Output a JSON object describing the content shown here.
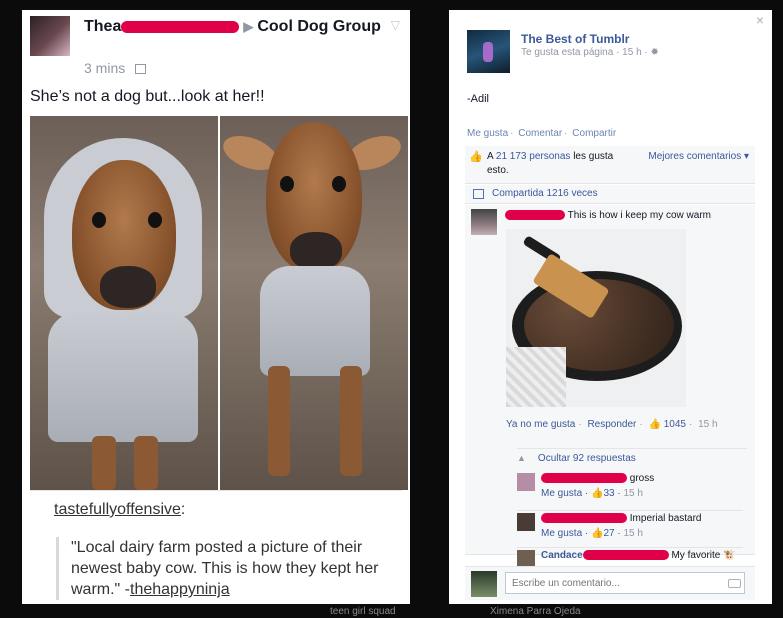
{
  "post": {
    "author_first": "Thea",
    "target_group": "Cool Dog Group",
    "time": "3 mins",
    "text": "She’s not a dog but...look at her!!",
    "source_user": "tastefullyoffensive",
    "source_colon": ":",
    "quote": "\"Local dairy farm posted a picture of their newest baby cow. This is how they kept her warm.\" -",
    "quote_author": "thehappyninja"
  },
  "panel": {
    "page_name": "The Best of Tumblr",
    "page_meta": "Te gusta esta página · 15 h ·",
    "caption": "-Adil",
    "actions": [
      "Me gusta",
      "Comentar",
      "Compartir"
    ],
    "likes_prefix": "A",
    "likes_count": "21 173 personas",
    "likes_suffix": "les gusta esto.",
    "sort_label": "Mejores comentarios ▾",
    "shares": "Compartida 1216 veces",
    "comment": {
      "text": "This is how i keep my cow warm",
      "unlike": "Ya no me gusta",
      "reply": "Responder",
      "likes": "1045",
      "time": "15 h"
    },
    "hide_replies": "Ocultar 92 respuestas",
    "replies": [
      {
        "text": "gross",
        "action": "Me gusta",
        "likes": "33",
        "time": "15 h"
      },
      {
        "text": "Imperial bastard",
        "action": "Me gusta",
        "likes": "27",
        "time": "15 h"
      },
      {
        "name_fragment": "Candace",
        "text": "My favorite"
      }
    ],
    "compose_placeholder": "Escribe un comentario..."
  },
  "background": {
    "label_left": "teen girl squad",
    "label_right": "Ximena Parra Ojeda"
  }
}
